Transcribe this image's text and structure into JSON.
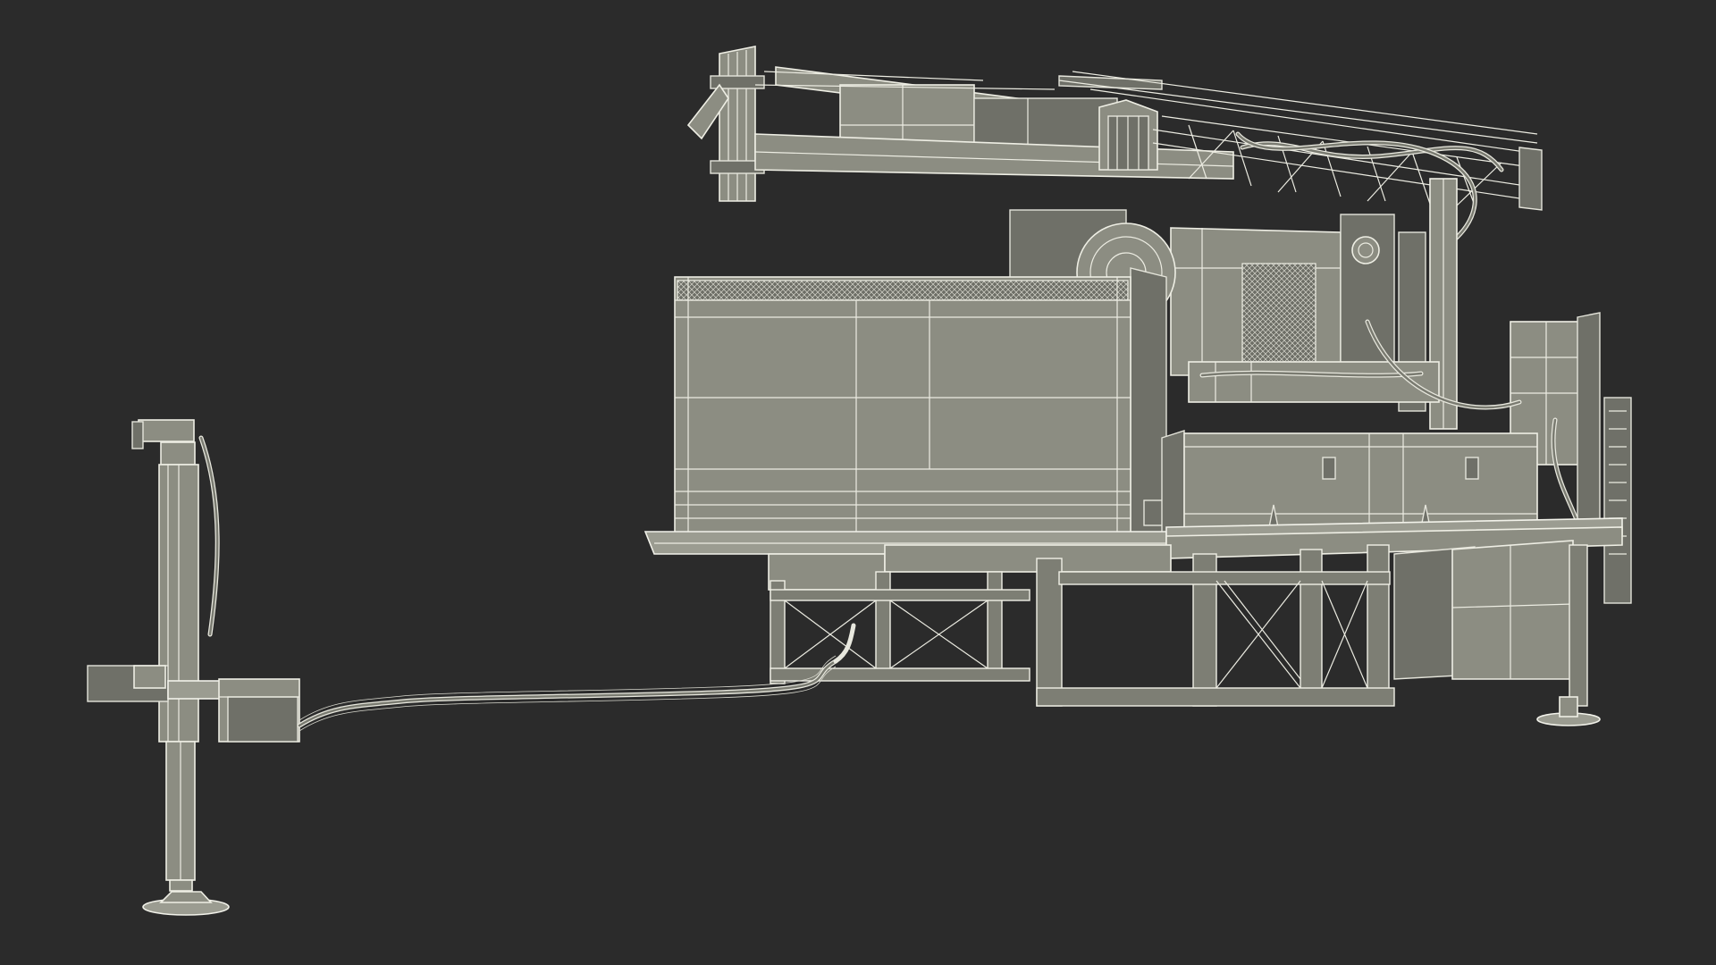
{
  "scene": {
    "background": "#2b2b2b",
    "model_fill": "#8c8d82",
    "wire_color": "#eeeee4"
  }
}
